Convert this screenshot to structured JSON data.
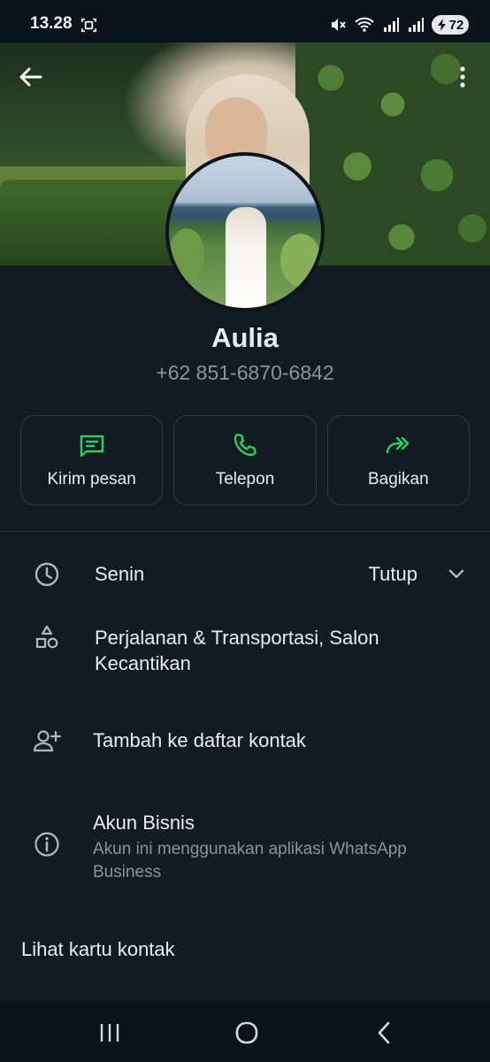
{
  "status_bar": {
    "time": "13.28",
    "battery": "72"
  },
  "profile": {
    "name": "Aulia",
    "phone": "+62 851-6870-6842"
  },
  "actions": [
    {
      "label": "Kirim pesan",
      "icon": "message-icon"
    },
    {
      "label": "Telepon",
      "icon": "phone-icon"
    },
    {
      "label": "Bagikan",
      "icon": "share-icon"
    }
  ],
  "business_hours": {
    "day": "Senin",
    "status": "Tutup"
  },
  "category": {
    "line1": "Perjalanan & Transportasi, Salon",
    "line2": "Kecantikan"
  },
  "add_contact": {
    "label": "Tambah ke daftar kontak"
  },
  "business_account": {
    "title": "Akun Bisnis",
    "line1": "Akun ini menggunakan aplikasi WhatsApp",
    "line2": "Business"
  },
  "contact_card_label": "Lihat kartu kontak",
  "colors": {
    "accent": "#25d366",
    "background": "#111b21",
    "secondary_text": "#8696a0"
  }
}
